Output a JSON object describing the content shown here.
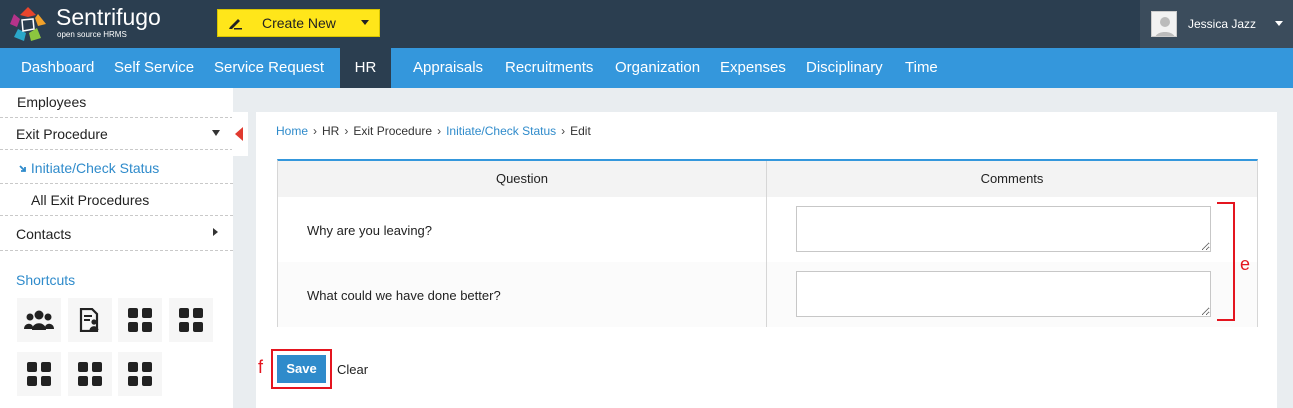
{
  "app": {
    "brand": "Sentrifugo",
    "brand_sub": "open source HRMS",
    "create_new_label": "Create New",
    "user_name": "Jessica Jazz"
  },
  "nav": {
    "items": [
      "Dashboard",
      "Self Service",
      "Service Request",
      "HR",
      "Appraisals",
      "Recruitments",
      "Organization",
      "Expenses",
      "Disciplinary",
      "Time"
    ],
    "active": "HR"
  },
  "sidebar": {
    "items": {
      "employees": "Employees",
      "exit_procedure": "Exit Procedure",
      "initiate_check_status": "Initiate/Check Status",
      "all_exit_procedures": "All Exit Procedures",
      "contacts": "Contacts"
    },
    "shortcuts_title": "Shortcuts",
    "shortcut_icons": [
      "people-icon",
      "document-user-icon",
      "grid-icon",
      "grid-icon",
      "grid-icon",
      "grid-icon",
      "grid-icon"
    ]
  },
  "breadcrumb": [
    "Home",
    "HR",
    "Exit Procedure",
    "Initiate/Check Status",
    "Edit"
  ],
  "table": {
    "headers": [
      "Question",
      "Comments"
    ],
    "rows": [
      {
        "question": "Why are you leaving?",
        "comment": ""
      },
      {
        "question": "What could we have done better?",
        "comment": ""
      }
    ]
  },
  "actions": {
    "save_label": "Save",
    "clear_label": "Clear"
  },
  "annotations": {
    "comments_marker": "e",
    "save_marker": "f"
  },
  "colors": {
    "topbar": "#2b3e50",
    "nav": "#3497dc",
    "create_button": "#ffe61a",
    "link": "#2f8bcb",
    "annotation": "#e4151f"
  }
}
